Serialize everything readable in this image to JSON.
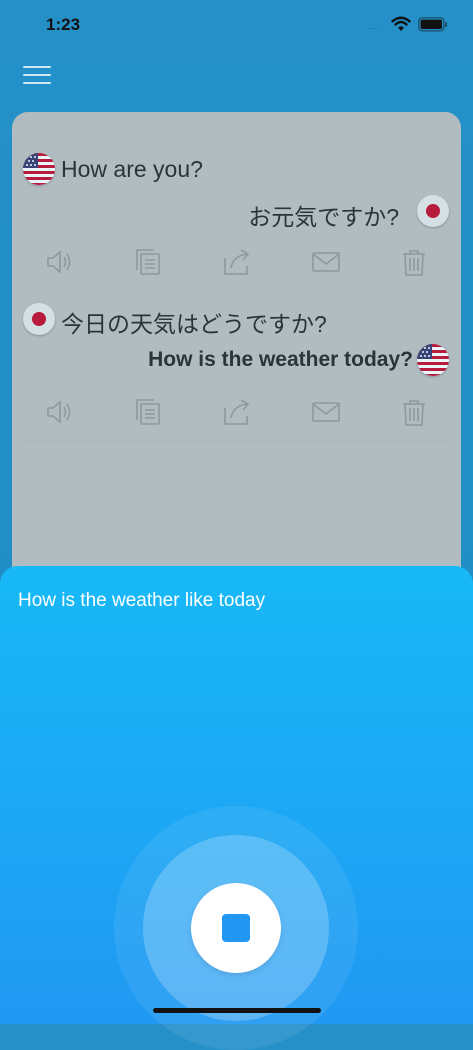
{
  "status_bar": {
    "time": "1:23",
    "signal_text": "····"
  },
  "menu": {
    "icon": "hamburger-menu-icon"
  },
  "conversation": [
    {
      "source_lang": "en-US",
      "source_flag": "us-flag-icon",
      "source_text": "How are you?",
      "target_lang": "ja",
      "target_flag": "japan-flag-icon",
      "translated_text": "お元気ですか?"
    },
    {
      "source_lang": "ja",
      "source_flag": "japan-flag-icon",
      "source_text": "今日の天気はどうですか?",
      "target_lang": "en-US",
      "target_flag": "us-flag-icon",
      "translated_text": "How is the weather today?"
    }
  ],
  "message_actions": [
    "speaker-icon",
    "copy-icon",
    "share-icon",
    "mail-icon",
    "trash-icon"
  ],
  "voice_input": {
    "recognized_text": "How is the weather like today",
    "stop_icon": "stop-icon"
  },
  "colors": {
    "background": "#1d8cc4",
    "sheet_top": "#18b9f7",
    "sheet_bottom": "#2098f2",
    "stop_accent": "#2196f3",
    "jp_red": "#c8102e"
  }
}
